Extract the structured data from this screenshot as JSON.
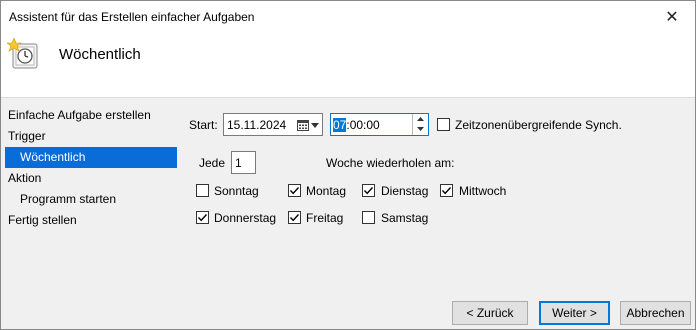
{
  "window": {
    "title": "Assistent für das Erstellen einfacher Aufgaben",
    "close_glyph": "✕"
  },
  "header": {
    "heading": "Wöchentlich",
    "icon": "clock-scheduler-icon"
  },
  "nav": {
    "items": [
      {
        "label": "Einfache Aufgabe erstellen"
      },
      {
        "label": "Trigger"
      },
      {
        "label": "Wöchentlich"
      },
      {
        "label": "Aktion"
      },
      {
        "label": "Programm starten"
      },
      {
        "label": "Fertig stellen"
      }
    ]
  },
  "form": {
    "start_label": "Start:",
    "date_value": "15.11.2024",
    "time_hour": "07",
    "time_rest": ":00:00",
    "sync_label": "Zeitzonenübergreifende Synch.",
    "sync_checked": false,
    "every_label": "Jede",
    "every_value": "1",
    "repeat_label": "Woche wiederholen am:",
    "days": [
      {
        "label": "Sonntag",
        "checked": false
      },
      {
        "label": "Montag",
        "checked": true
      },
      {
        "label": "Dienstag",
        "checked": true
      },
      {
        "label": "Mittwoch",
        "checked": true
      },
      {
        "label": "Donnerstag",
        "checked": true
      },
      {
        "label": "Freitag",
        "checked": true
      },
      {
        "label": "Samstag",
        "checked": false
      }
    ]
  },
  "buttons": {
    "back": "< Zurück",
    "next": "Weiter >",
    "cancel": "Abbrechen"
  },
  "colors": {
    "selection": "#0a6cd6",
    "accent": "#0078d7"
  }
}
